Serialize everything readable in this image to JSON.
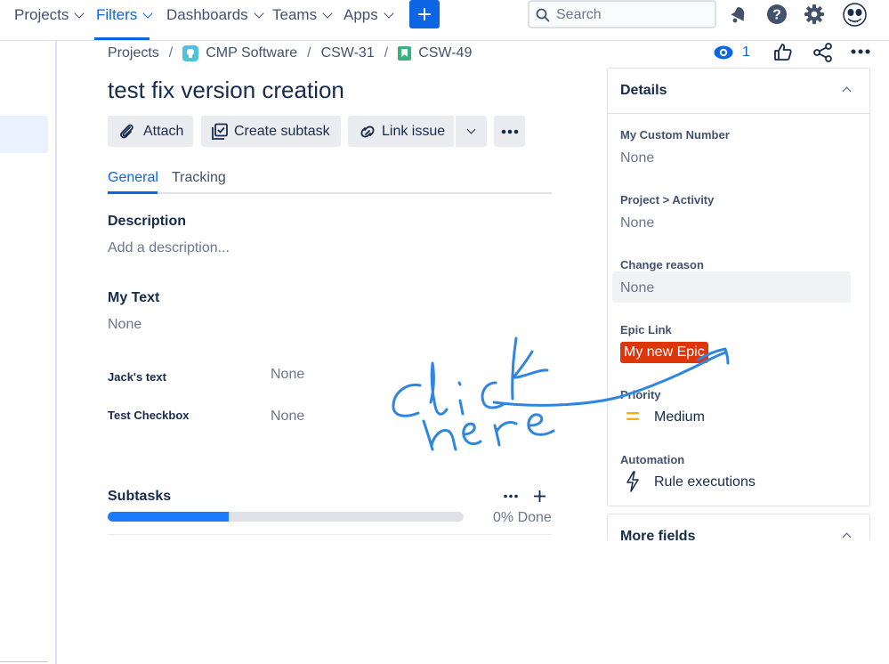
{
  "topnav": {
    "items": [
      "Projects",
      "Filters",
      "Dashboards",
      "Teams",
      "Apps"
    ],
    "search_placeholder": "Search"
  },
  "breadcrumb": {
    "projects": "Projects",
    "project": "CMP Software",
    "parent": "CSW-31",
    "issue": "CSW-49"
  },
  "issue": {
    "watch_count": "1",
    "title": "test fix version creation",
    "actions": {
      "attach": "Attach",
      "create_subtask": "Create subtask",
      "link_issue": "Link issue"
    },
    "tabs": [
      "General",
      "Tracking"
    ],
    "description_label": "Description",
    "description_placeholder": "Add a description...",
    "my_text_label": "My Text",
    "my_text_value": "None",
    "jacks_text_label": "Jack's text",
    "jacks_text_value": "None",
    "test_checkbox_label": "Test Checkbox",
    "test_checkbox_value": "None",
    "subtasks_label": "Subtasks",
    "subtasks_progress_text": "0% Done",
    "subtasks_progress": 0.34
  },
  "details": {
    "title": "Details",
    "fields": [
      {
        "label": "My Custom Number",
        "value": "None"
      },
      {
        "label": "Project > Activity",
        "value": "None"
      },
      {
        "label": "Change reason",
        "value": "None"
      },
      {
        "label": "Epic Link",
        "value": "My new Epic"
      },
      {
        "label": "Priority",
        "value": "Medium"
      },
      {
        "label": "Automation",
        "value": "Rule executions"
      }
    ],
    "more_fields": "More fields"
  },
  "colors": {
    "accent": "#0c66e4",
    "epic": "#de350b",
    "priority_medium": "#ffab00",
    "annotation": "#2f86e0"
  }
}
